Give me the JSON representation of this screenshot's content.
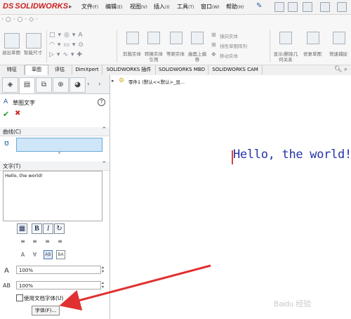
{
  "app": {
    "logo_prefix": "DS",
    "logo_text": "SOLIDWORKS"
  },
  "menu": [
    {
      "label": "文件",
      "accel": "(F)"
    },
    {
      "label": "编辑",
      "accel": "(E)"
    },
    {
      "label": "视图",
      "accel": "(V)"
    },
    {
      "label": "插入",
      "accel": "(I)"
    },
    {
      "label": "工具",
      "accel": "(T)"
    },
    {
      "label": "窗口",
      "accel": "(W)"
    },
    {
      "label": "帮助",
      "accel": "(H)"
    }
  ],
  "command_groups": {
    "exit_sketch": "退出草图",
    "smart_dim": "智能尺寸",
    "trim": "剪裁实体",
    "convert": "转换实体引用",
    "offset": "等距实体",
    "on_surface": "曲面上偏移",
    "mirror": "镜向实体",
    "linear_pattern": "线性草图阵列",
    "move": "移动实体",
    "display_relations": "显示/删除几何关系",
    "repair": "修复草图",
    "quick_snap": "快速捕捉"
  },
  "tabs": [
    "特征",
    "草图",
    "评估",
    "DimXpert",
    "SOLIDWORKS 插件",
    "SOLIDWORKS MBD",
    "SOLIDWORKS CAM"
  ],
  "active_tab": "草图",
  "tree": {
    "item": "零件1 (默认<<默认>_显..."
  },
  "property_manager": {
    "title": "草图文字",
    "help": "?",
    "ok": "✔",
    "cancel": "✖",
    "curves_label": "曲线(C)",
    "text_label": "文字(T)",
    "text_value": "Hello, the world!",
    "width_factor": "100%",
    "spacing": "100%",
    "use_doc_font_label": "使用文档字体(U)",
    "font_button": "字体(F)..."
  },
  "graphics": {
    "text": "Hello, the world!"
  },
  "watermark": "Baidu 经验"
}
